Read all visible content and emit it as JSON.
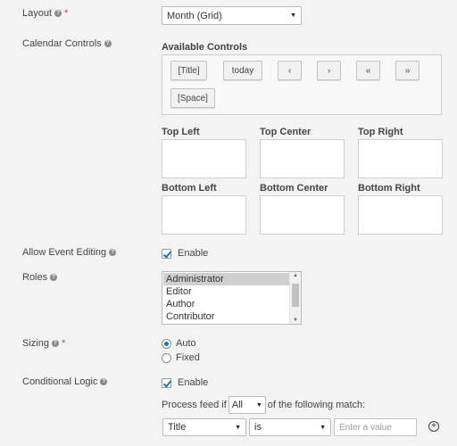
{
  "layout": {
    "label": "Layout",
    "value": "Month (Grid)"
  },
  "calendar_controls": {
    "label": "Calendar Controls",
    "available_title": "Available Controls",
    "controls": [
      "[Title]",
      "today",
      "‹",
      "›",
      "«",
      "»",
      "[Space]"
    ],
    "zones": [
      "Top Left",
      "Top Center",
      "Top Right",
      "Bottom Left",
      "Bottom Center",
      "Bottom Right"
    ]
  },
  "event_editing": {
    "label": "Allow Event Editing",
    "checkbox_label": "Enable",
    "checked": true
  },
  "roles": {
    "label": "Roles",
    "options": [
      "Administrator",
      "Editor",
      "Author",
      "Contributor"
    ],
    "selected": "Administrator"
  },
  "sizing": {
    "label": "Sizing",
    "options": [
      "Auto",
      "Fixed"
    ],
    "selected": "Auto"
  },
  "conditional_logic": {
    "label": "Conditional Logic",
    "checkbox_label": "Enable",
    "checked": true,
    "process_prefix": "Process feed if",
    "match_value": "All",
    "process_suffix": "of the following match:",
    "rule": {
      "field": "Title",
      "operator": "is",
      "value_placeholder": "Enter a value"
    }
  },
  "colors": {
    "accent": "#2271b1",
    "required": "#d63638"
  }
}
